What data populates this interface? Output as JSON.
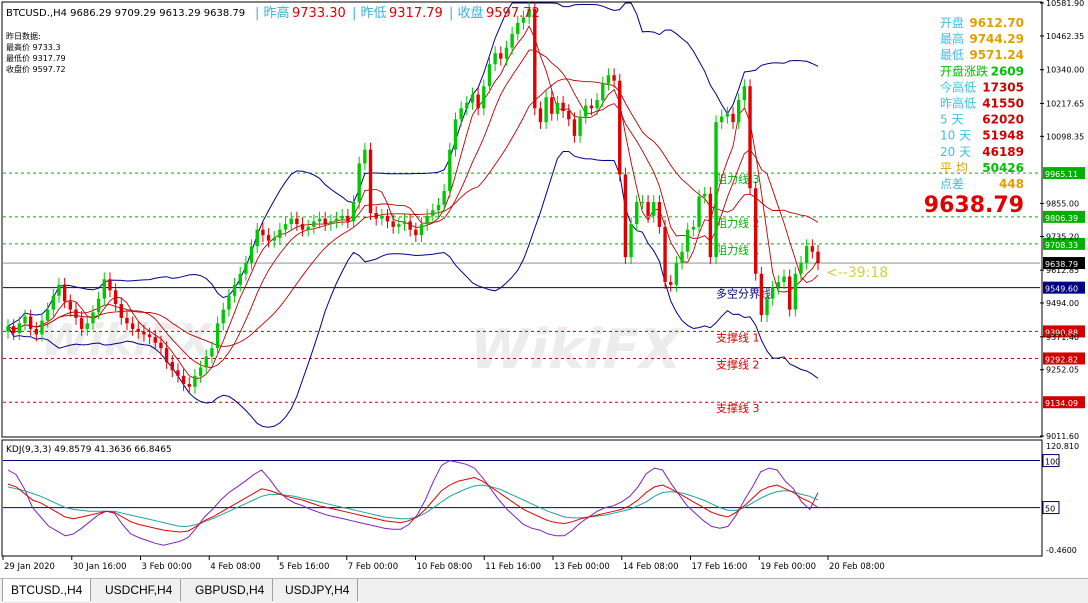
{
  "window": {
    "symbol_info": "BTCUSD.,H4  9686.29 9709.29 9613.29 9638.79",
    "yesterday_title": "昨日数据:",
    "yesterday_lines": [
      "最高价 9733.3",
      "最低价 9317.79",
      "收盘价 9597.72"
    ],
    "top_summary": [
      {
        "label": "| 昨高",
        "value": "9733.30"
      },
      {
        "label": "| 昨低",
        "value": "9317.79"
      },
      {
        "label": "| 收盘",
        "value": "9597.72"
      }
    ],
    "watermark": "WikiFX"
  },
  "stats_panel": [
    {
      "label": "开盘",
      "value": "9612.70",
      "label_color": "#40c0e0",
      "value_color": "#e0a000"
    },
    {
      "label": "最高",
      "value": "9744.29",
      "label_color": "#40c0e0",
      "value_color": "#e0a000"
    },
    {
      "label": "最低",
      "value": "9571.24",
      "label_color": "#40c0e0",
      "value_color": "#e0a000"
    },
    {
      "label": "开盘涨跌",
      "value": "2609",
      "label_color": "#00c000",
      "value_color": "#00c000"
    },
    {
      "label": "今高低",
      "value": "17305",
      "label_color": "#40c0e0",
      "value_color": "#d00000"
    },
    {
      "label": "昨高低",
      "value": "41550",
      "label_color": "#40c0e0",
      "value_color": "#d00000"
    },
    {
      "label": "5   天",
      "value": "62020",
      "label_color": "#40c0e0",
      "value_color": "#d00000"
    },
    {
      "label": "10  天",
      "value": "51948",
      "label_color": "#40c0e0",
      "value_color": "#d00000"
    },
    {
      "label": "20  天",
      "value": "46189",
      "label_color": "#40c0e0",
      "value_color": "#d00000"
    },
    {
      "label": "平   均",
      "value": "50426",
      "label_color": "#e0a000",
      "value_color": "#00c000"
    },
    {
      "label": "点差",
      "value": "448",
      "label_color": "#40c0e0",
      "value_color": "#e0a000"
    }
  ],
  "big_price": "9638.79",
  "countdown": "<--39:18",
  "kdj_label": "KDJ(9,3,3) 49.8579 41.3636 66.8465",
  "tabs": [
    "BTCUSD.,H4",
    "USDCHF,H4",
    "GBPUSD,H4",
    "USDJPY,H4"
  ],
  "colors": {
    "bull": "#00c800",
    "bear": "#e00000",
    "bollinger": "#00008b",
    "ma": "#c00000",
    "resistance": "#00b000",
    "support": "#d00000",
    "divider": "#000080"
  },
  "chart_data": [
    {
      "type": "candlestick",
      "title": "BTCUSD.,H4",
      "ylim": [
        9011.6,
        10581.9
      ],
      "y_ticks": [
        "10581.90",
        "10462.35",
        "10340.00",
        "10217.65",
        "10098.35",
        "9855.00",
        "9735.20",
        "9612.85",
        "9494.00",
        "9371.40",
        "9252.05",
        "9011.60"
      ],
      "x_ticks": [
        "29 Jan 2020",
        "30 Jan 16:00",
        "3 Feb 00:00",
        "4 Feb 08:00",
        "5 Feb 16:00",
        "7 Feb 00:00",
        "10 Feb 08:00",
        "11 Feb 16:00",
        "13 Feb 00:00",
        "14 Feb 08:00",
        "17 Feb 16:00",
        "19 Feb 00:00",
        "20 Feb 08:00"
      ],
      "levels": [
        {
          "name": "阻力线 3",
          "value": 9965.11,
          "kind": "resistance"
        },
        {
          "name": "阻力线 2",
          "value": 9806.39,
          "kind": "resistance"
        },
        {
          "name": "阻力线 1",
          "value": 9708.33,
          "kind": "resistance"
        },
        {
          "name": "多空分界线",
          "value": 9549.6,
          "kind": "divider"
        },
        {
          "name": "支撑线 1",
          "value": 9390.88,
          "kind": "support"
        },
        {
          "name": "支撑线 2",
          "value": 9292.82,
          "kind": "support"
        },
        {
          "name": "支撑线 3",
          "value": 9134.09,
          "kind": "support"
        }
      ],
      "current_price": 9638.79,
      "close_series": [
        9410,
        9385,
        9420,
        9445,
        9400,
        9380,
        9430,
        9470,
        9520,
        9560,
        9500,
        9470,
        9440,
        9400,
        9420,
        9460,
        9510,
        9580,
        9540,
        9490,
        9440,
        9420,
        9400,
        9390,
        9380,
        9370,
        9350,
        9330,
        9280,
        9250,
        9230,
        9200,
        9190,
        9230,
        9260,
        9300,
        9330,
        9420,
        9470,
        9520,
        9560,
        9600,
        9640,
        9700,
        9760,
        9740,
        9720,
        9730,
        9760,
        9780,
        9800,
        9780,
        9760,
        9770,
        9790,
        9800,
        9780,
        9790,
        9800,
        9810,
        9790,
        9860,
        10000,
        10050,
        9820,
        9800,
        9810,
        9790,
        9770,
        9780,
        9790,
        9760,
        9740,
        9780,
        9810,
        9830,
        9850,
        9900,
        10050,
        10160,
        10200,
        10220,
        10250,
        10200,
        10280,
        10360,
        10400,
        10380,
        10420,
        10470,
        10510,
        10530,
        10560,
        10200,
        10150,
        10240,
        10180,
        10220,
        10190,
        10160,
        10100,
        10170,
        10210,
        10200,
        10230,
        10290,
        10320,
        10300,
        9960,
        9660,
        9780,
        9860,
        9860,
        9810,
        9860,
        9770,
        9570,
        9560,
        9640,
        9680,
        9760,
        9770,
        9880,
        9890,
        9660,
        10150,
        10170,
        10180,
        10150,
        10230,
        10280,
        9910,
        9600,
        9450,
        9510,
        9550,
        9570,
        9590,
        9470,
        9600,
        9640,
        9700,
        9680,
        9638
      ],
      "kdj": {
        "ylim": [
          -0.46,
          120.81
        ],
        "levels": [
          100,
          50
        ],
        "K": [
          75,
          72,
          65,
          58,
          55,
          50,
          45,
          40,
          38,
          40,
          42,
          44,
          46,
          45,
          40,
          35,
          32,
          30,
          28,
          26,
          25,
          24,
          25,
          30,
          36,
          40,
          45,
          50,
          55,
          60,
          65,
          70,
          68,
          65,
          62,
          60,
          58,
          55,
          52,
          50,
          48,
          46,
          44,
          42,
          40,
          38,
          36,
          35,
          34,
          36,
          40,
          48,
          58,
          68,
          74,
          78,
          80,
          82,
          78,
          72,
          66,
          60,
          54,
          48,
          44,
          40,
          36,
          34,
          33,
          35,
          38,
          40,
          42,
          44,
          46,
          48,
          52,
          58,
          66,
          72,
          74,
          70,
          65,
          60,
          55,
          50,
          45,
          42,
          40,
          45,
          52,
          60,
          68,
          72,
          74,
          70,
          66,
          60,
          56,
          50
        ],
        "D": [
          72,
          70,
          68,
          65,
          62,
          58,
          54,
          50,
          48,
          47,
          46,
          46,
          46,
          46,
          44,
          42,
          40,
          38,
          36,
          34,
          32,
          30,
          30,
          32,
          35,
          38,
          42,
          46,
          50,
          54,
          58,
          62,
          64,
          64,
          63,
          62,
          60,
          58,
          56,
          54,
          52,
          50,
          48,
          46,
          44,
          42,
          40,
          39,
          38,
          38,
          40,
          44,
          50,
          56,
          62,
          66,
          70,
          73,
          74,
          72,
          70,
          66,
          62,
          58,
          54,
          50,
          46,
          43,
          40,
          39,
          39,
          40,
          41,
          42,
          44,
          46,
          48,
          52,
          56,
          62,
          66,
          67,
          66,
          64,
          61,
          58,
          54,
          50,
          47,
          47,
          50,
          55,
          60,
          64,
          67,
          68,
          67,
          64,
          62,
          58
        ],
        "J": [
          90,
          85,
          70,
          50,
          40,
          30,
          25,
          20,
          22,
          28,
          35,
          42,
          46,
          44,
          32,
          22,
          18,
          15,
          12,
          10,
          12,
          14,
          18,
          28,
          40,
          48,
          58,
          66,
          72,
          78,
          85,
          90,
          80,
          68,
          60,
          55,
          52,
          48,
          45,
          42,
          40,
          38,
          36,
          34,
          32,
          30,
          28,
          27,
          27,
          32,
          42,
          58,
          78,
          95,
          100,
          98,
          96,
          92,
          82,
          70,
          58,
          48,
          40,
          32,
          28,
          26,
          22,
          20,
          20,
          26,
          34,
          40,
          46,
          50,
          52,
          56,
          62,
          72,
          86,
          92,
          90,
          76,
          64,
          52,
          44,
          36,
          30,
          28,
          30,
          42,
          58,
          72,
          88,
          92,
          90,
          78,
          70,
          56,
          48,
          66
        ]
      }
    }
  ]
}
